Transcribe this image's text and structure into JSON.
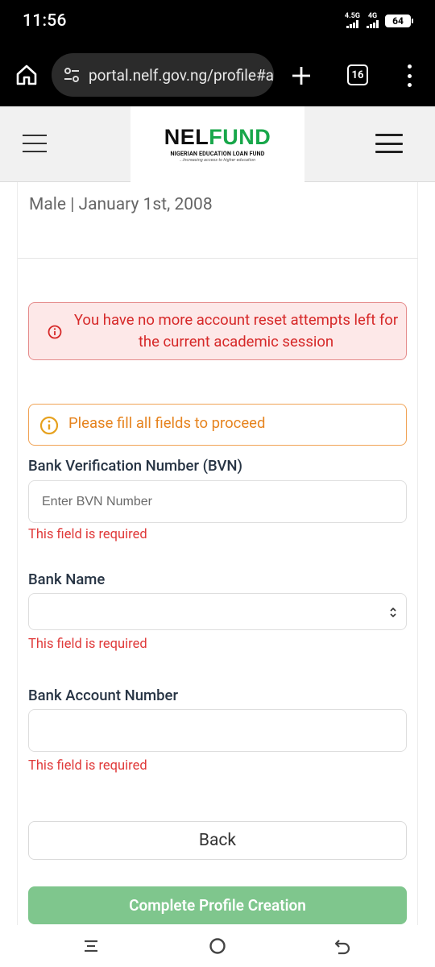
{
  "status_bar": {
    "time": "11:56",
    "network1": "4.5G",
    "network2": "4G",
    "battery": "64"
  },
  "browser": {
    "url": "portal.nelf.gov.ng/profile#ac",
    "tab_count": "16",
    "icons": [
      "home-icon",
      "site-settings-icon",
      "new-tab-plus-icon",
      "tab-switcher-icon",
      "more-menu-icon"
    ]
  },
  "site_header": {
    "logo_nel": "NEL",
    "logo_fund": "FUND",
    "logo_subtitle": "NIGERIAN EDUCATION LOAN FUND",
    "logo_tagline": "...Increasing access to higher education",
    "brand_color": "#18a74a"
  },
  "profile": {
    "gender_dob": "Male | January 1st, 2008"
  },
  "alerts": {
    "error_text": "You have no more account reset attempts left for the current academic session",
    "warning_text": "Please fill all fields to proceed"
  },
  "form": {
    "bvn": {
      "label": "Bank Verification Number (BVN)",
      "placeholder": "Enter BVN Number",
      "value": "",
      "error": "This field is required"
    },
    "bank_name": {
      "label": "Bank Name",
      "value": "",
      "error": "This field is required"
    },
    "account_number": {
      "label": "Bank Account Number",
      "value": "",
      "error": "This field is required"
    }
  },
  "buttons": {
    "back": "Back",
    "submit": "Complete Profile Creation"
  },
  "colors": {
    "error_red": "#d62828",
    "warning_orange": "#e6831e",
    "submit_green": "#7fc68d"
  }
}
